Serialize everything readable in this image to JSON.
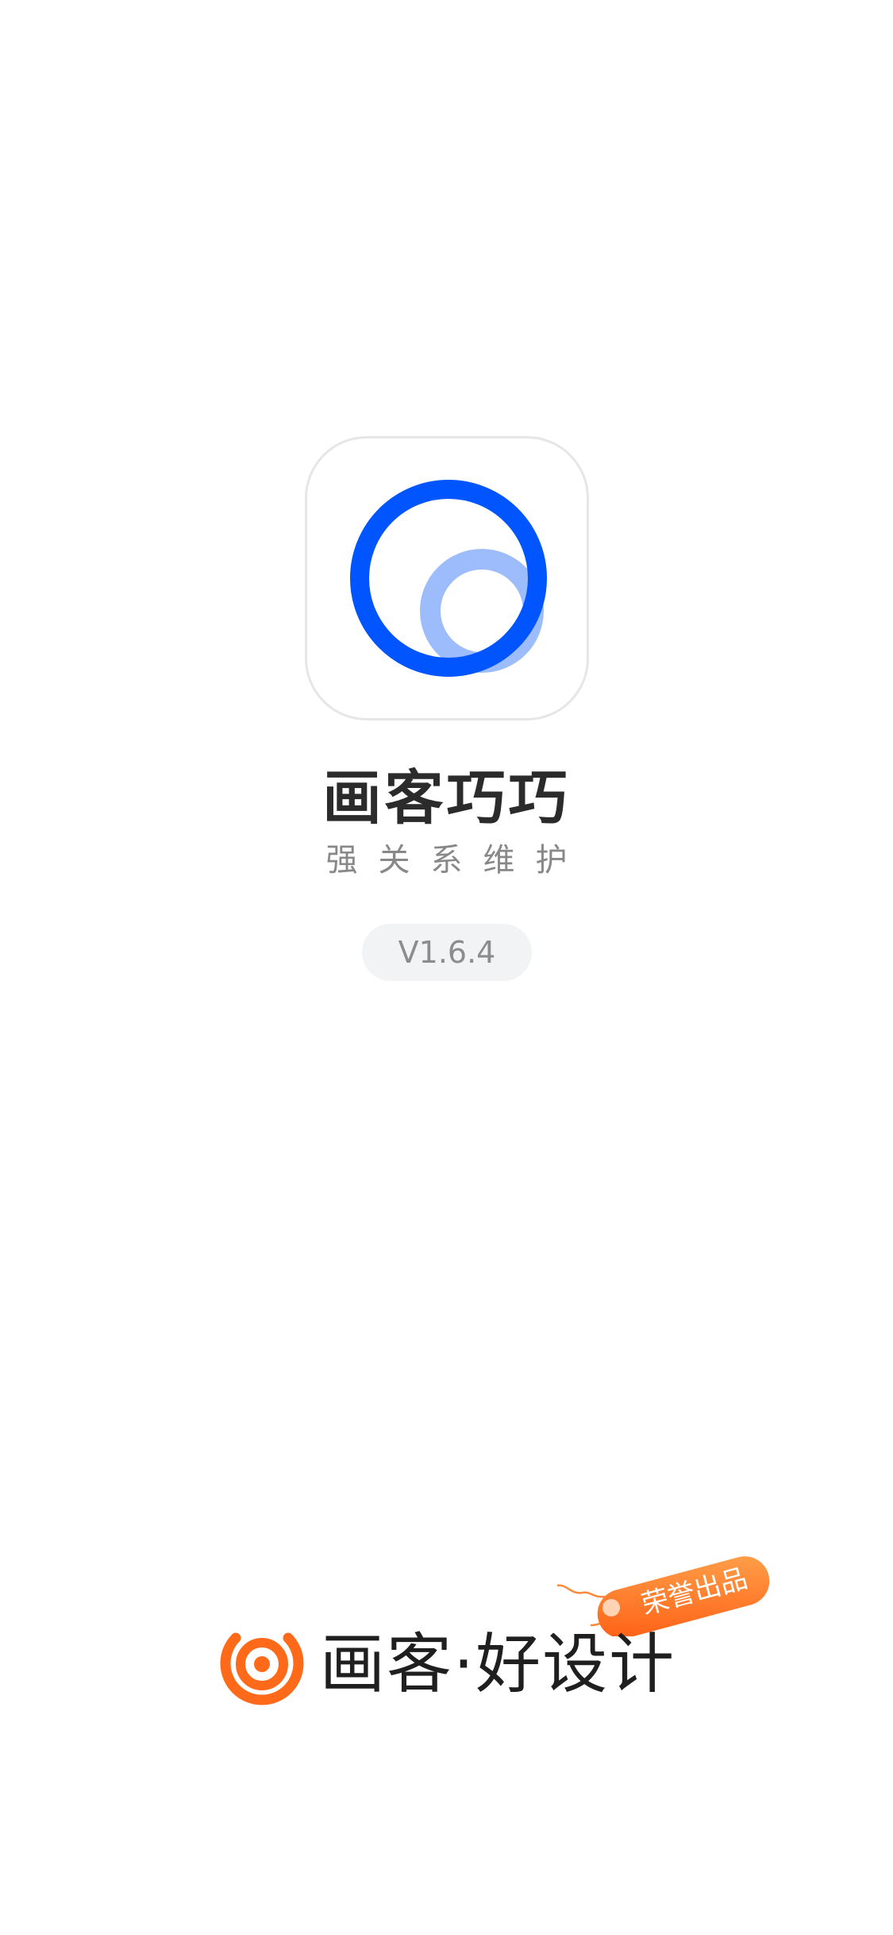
{
  "splash": {
    "app_name": "画客巧巧",
    "tagline": "强关系维护",
    "version": "V1.6.4",
    "app_icon": "double-ring-logo-icon",
    "brand": {
      "logo_icon": "target-eye-logo-icon",
      "name": "画客·好设计",
      "honor_tag": "荣誉出品"
    }
  },
  "colors": {
    "logo_blue": "#0055ff",
    "logo_light_blue": "#9dbcfb",
    "brand_orange": "#ff6a1a",
    "badge_background": "#f2f3f5"
  }
}
